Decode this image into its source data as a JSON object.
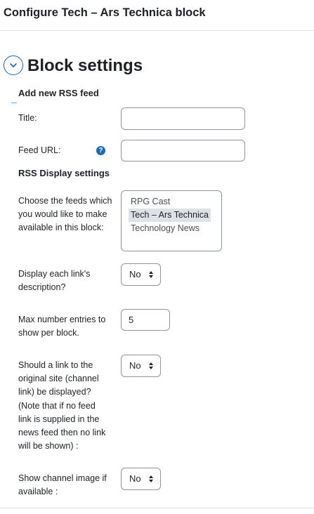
{
  "header": {
    "title": "Configure Tech – Ars Technica block"
  },
  "section": {
    "title": "Block settings",
    "toggle_icon": "chevron-down-icon"
  },
  "add_feed": {
    "heading": "Add new RSS feed",
    "title_label": "Title:",
    "title_value": "",
    "url_label": "Feed URL:",
    "url_value": "",
    "help_icon": "?"
  },
  "display": {
    "heading": "RSS Display settings",
    "feeds_label": "Choose the feeds which you would like to make available in this block:",
    "feeds": [
      {
        "label": "RPG Cast",
        "selected": false
      },
      {
        "label": "Tech – Ars Technica",
        "selected": true
      },
      {
        "label": "Technology News",
        "selected": false
      }
    ],
    "description_label": "Display each link's description?",
    "description_value": "No",
    "max_entries_label": "Max number entries to show per block.",
    "max_entries_value": "5",
    "channel_link_label": "Should a link to the original site (channel link) be displayed? (Note that if no feed link is supplied in the news feed then no link will be shown) :",
    "channel_link_value": "No",
    "channel_image_label": "Show channel image if available :",
    "channel_image_value": "No"
  }
}
